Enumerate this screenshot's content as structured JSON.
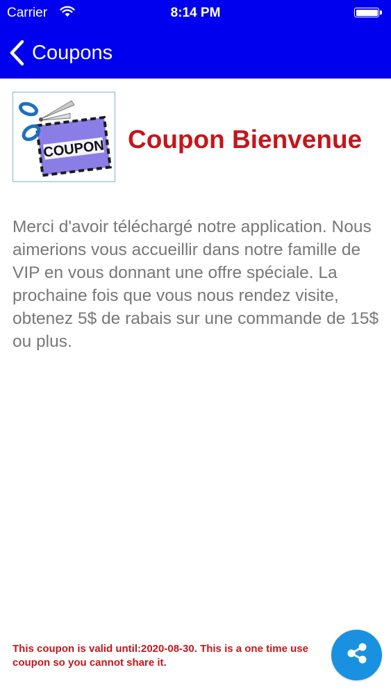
{
  "status_bar": {
    "carrier": "Carrier",
    "time": "8:14 PM",
    "wifi_icon": "wifi-icon",
    "battery_icon": "battery-icon",
    "battery_level": 1.0
  },
  "nav": {
    "back_label": "Coupons",
    "back_icon": "chevron-left-icon",
    "background_color": "#0000ee"
  },
  "coupon": {
    "image_label": "COUPON",
    "title": "Coupon Bienvenue",
    "title_color": "#c4161c",
    "description": "Merci d'avoir téléchargé notre application. Nous aimerions vous accueillir dans notre famille de VIP en vous donnant une offre spéciale. La prochaine fois que vous nous rendez visite, obtenez 5$ de rabais sur une commande de 15$ ou plus.",
    "validity_note": "This coupon is valid until:2020-08-30. This is a one time use coupon so you cannot share it."
  },
  "share": {
    "icon": "share-icon",
    "color": "#1a91e0"
  }
}
